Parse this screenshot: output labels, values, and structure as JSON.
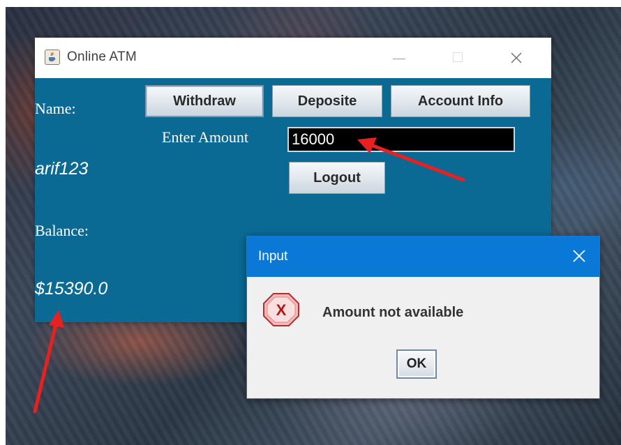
{
  "window": {
    "title": "Online ATM",
    "icon": "java-cup-icon"
  },
  "account": {
    "name_label": "Name:",
    "name_value": "arif123",
    "balance_label": "Balance:",
    "balance_value": "$15390.0"
  },
  "toolbar": {
    "withdraw_label": "Withdraw",
    "deposit_label": "Deposite",
    "account_info_label": "Account Info",
    "logout_label": "Logout"
  },
  "amount": {
    "label": "Enter Amount",
    "value": "16000"
  },
  "dialog": {
    "title": "Input",
    "message": "Amount not available",
    "ok_label": "OK",
    "icon": "error-icon"
  },
  "colors": {
    "window_body": "#0a6a94",
    "dialog_titlebar": "#0a78d7",
    "annotation_arrow": "#e8201f",
    "amount_field_bg": "#000000"
  }
}
